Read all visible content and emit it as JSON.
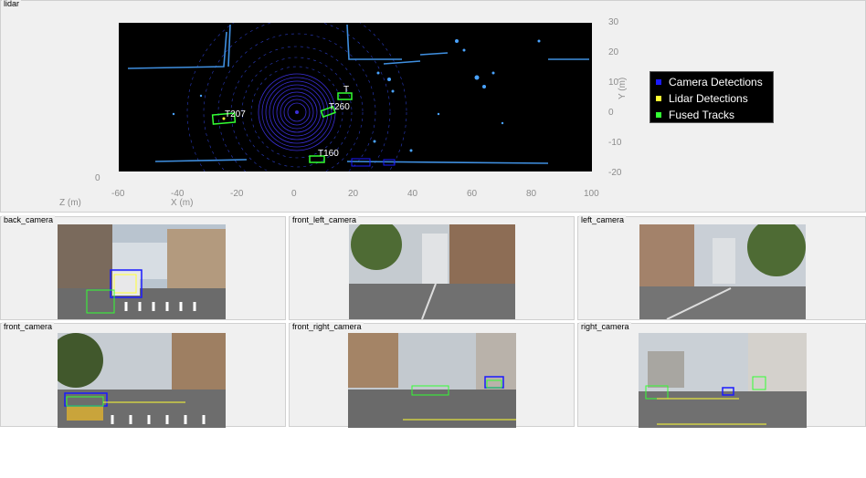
{
  "lidar_panel": {
    "title": "lidar",
    "x_ticks": [
      "-60",
      "-40",
      "-20",
      "0",
      "20",
      "40",
      "60",
      "80",
      "100"
    ],
    "y_ticks": [
      "30",
      "20",
      "10",
      "0",
      "-10",
      "-20"
    ],
    "z_tick": "0",
    "x_label": "X (m)",
    "y_label": "Y (m)",
    "z_label": "Z (m)",
    "tracks": [
      "T207",
      "T260",
      "T160",
      "T"
    ],
    "legend": [
      {
        "label": "Camera Detections",
        "color": "#1a1aff"
      },
      {
        "label": "Lidar Detections",
        "color": "#ffff33"
      },
      {
        "label": "Fused Tracks",
        "color": "#33ff33"
      }
    ]
  },
  "camera_panels": [
    {
      "title": "back_camera"
    },
    {
      "title": "front_left_camera"
    },
    {
      "title": "left_camera"
    },
    {
      "title": "front_camera"
    },
    {
      "title": "front_right_camera"
    },
    {
      "title": "right_camera"
    }
  ],
  "colors": {
    "panel_bg": "#f0f0f0",
    "lidar_bg": "#000000",
    "camera_detection": "#1a1aff",
    "lidar_detection": "#ffff33",
    "fused_track": "#33ff33",
    "axis_text": "#8c8c8c"
  }
}
